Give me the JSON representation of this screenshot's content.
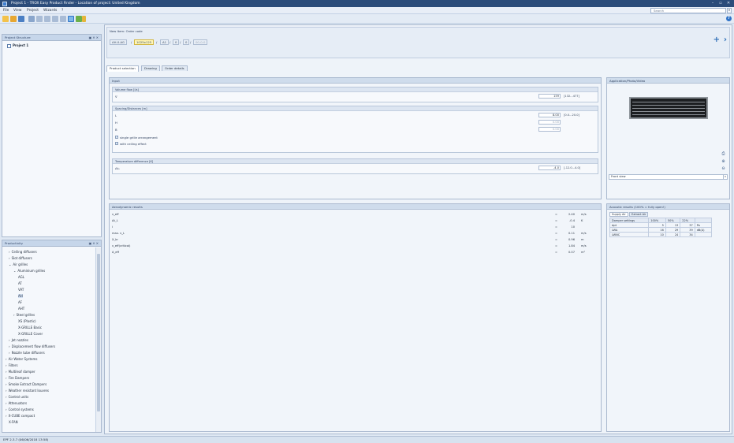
{
  "window": {
    "title": "Project 1 - TROX Easy Product Finder - Location of project: United Kingdom",
    "controls": [
      "–",
      "▫",
      "✕"
    ]
  },
  "menu": {
    "items": [
      "File",
      "View",
      "Project",
      "Wizards",
      "?"
    ],
    "search_placeholder": "Search"
  },
  "project_structure": {
    "title": "Project Structure",
    "pin": "▣ ✕ ✕",
    "root": "Project 1"
  },
  "products": {
    "title": "Productivity",
    "pin": "▣ ✕ ✕",
    "tree": [
      {
        "label": "Ceiling diffusers",
        "prefix": "›"
      },
      {
        "label": "Slot diffusers",
        "prefix": "›"
      },
      {
        "label": "Air grilles",
        "prefix": "⌄"
      },
      {
        "label": "Aluminium grilles",
        "prefix": "⌄"
      },
      {
        "label": "AGL",
        "prefix": ""
      },
      {
        "label": "AT",
        "prefix": ""
      },
      {
        "label": "VAT",
        "prefix": ""
      },
      {
        "label": "AH",
        "prefix": "",
        "selected": true
      },
      {
        "label": "AF",
        "prefix": ""
      },
      {
        "label": "AHT",
        "prefix": ""
      },
      {
        "label": "Steel grilles",
        "prefix": "›"
      },
      {
        "label": "XS (Plastic)",
        "prefix": ""
      },
      {
        "label": "X-GRILLE Basic",
        "prefix": ""
      },
      {
        "label": "X-GRILLE Cover",
        "prefix": ""
      },
      {
        "label": "Jet nozzles",
        "prefix": "›"
      },
      {
        "label": "Displacement flow diffusers",
        "prefix": "›"
      },
      {
        "label": "Nozzle tube diffusers",
        "prefix": "›"
      },
      {
        "label": "Air Water Systems",
        "prefix": "›"
      },
      {
        "label": "Filters",
        "prefix": "›"
      },
      {
        "label": "Multileaf damper",
        "prefix": "›"
      },
      {
        "label": "Fire Dampers",
        "prefix": "›"
      },
      {
        "label": "Smoke Extract Dampers",
        "prefix": "›"
      },
      {
        "label": "Weather resistant louvres",
        "prefix": "›"
      },
      {
        "label": "Control units",
        "prefix": "›"
      },
      {
        "label": "Attenuators",
        "prefix": "›"
      },
      {
        "label": "Control systems",
        "prefix": "›"
      },
      {
        "label": "X-CUBE compact",
        "prefix": "›"
      },
      {
        "label": "X-FAN",
        "prefix": ""
      }
    ]
  },
  "order_code": {
    "title": "New Item: Order code",
    "segments": [
      "AH-0-AG",
      "1025x125",
      "A1",
      "0",
      "0",
      "00-0-0"
    ],
    "separators": [
      "/",
      "/",
      "/",
      "/",
      "/"
    ]
  },
  "tabs": [
    "Product selection",
    "Drawing",
    "Order details"
  ],
  "input": {
    "title": "Input",
    "volume_flow": {
      "title": "Volume flow [l/s]",
      "label": "V̇",
      "value": "159",
      "range": "[132...477]"
    },
    "spacing": {
      "title": "Spacing/Distances [m]",
      "rows": [
        {
          "label": "L",
          "value": "8.00",
          "range": "[0.0...20.0]",
          "disabled": false
        },
        {
          "label": "H",
          "value": "0.00",
          "range": "",
          "disabled": true
        },
        {
          "label": "B",
          "value": "0.00",
          "range": "",
          "disabled": true
        }
      ],
      "checks": [
        {
          "label": "single grille arrangement",
          "checked": true
        },
        {
          "label": "with ceiling effect",
          "checked": true
        }
      ]
    },
    "temperature": {
      "title": "Temperature difference [K]",
      "label": "Δt₀",
      "value": "-4.0",
      "range": "[-12.0...4.0]"
    }
  },
  "aero": {
    "title": "Aerodynamic results",
    "rows": [
      {
        "label": "v_eff",
        "eq": "=",
        "value": "2.40",
        "unit": "m/s"
      },
      {
        "label": "Δt_L",
        "eq": "=",
        "value": "-0.4",
        "unit": "K"
      },
      {
        "label": "i",
        "eq": "=",
        "value": "10",
        "unit": ""
      },
      {
        "label": "max. v_L",
        "eq": "=",
        "value": "0.11",
        "unit": "m/s"
      },
      {
        "label": "X_kr",
        "eq": "=",
        "value": "0.96",
        "unit": "m"
      },
      {
        "label": "v_eff(critical)",
        "eq": "=",
        "value": "1.84",
        "unit": "m/s"
      },
      {
        "label": "A_eff",
        "eq": "=",
        "value": "0.07",
        "unit": "m²"
      }
    ]
  },
  "app_photo": {
    "title": "Application/Photo/Video",
    "view_combo": "Front view",
    "tool_icons": [
      "print-icon",
      "zoom-in-icon",
      "zoom-out-icon"
    ]
  },
  "acoustic": {
    "title": "Acoustic results (100% = fully open!)",
    "subtabs": [
      "Supply Air",
      "Extract Air"
    ],
    "headers": [
      "Damper settings",
      "100%",
      "50%",
      "22%",
      ""
    ],
    "rows": [
      [
        "Δpt",
        "5",
        "13",
        "37",
        "Pa"
      ],
      [
        "LWA",
        "16",
        "29",
        "39",
        "dB(A)"
      ],
      [
        "LWNC",
        "10",
        "24",
        "34",
        ""
      ]
    ]
  },
  "status_bar": "EPF 2.3.7 (06/06/2018 13:58)",
  "colors": {
    "titlebar": "#2b4c7a",
    "panel_header": "#c6d6ea",
    "background": "#dfe8f3",
    "active_segment": "#fff6b8",
    "accent": "#2f73c8"
  }
}
